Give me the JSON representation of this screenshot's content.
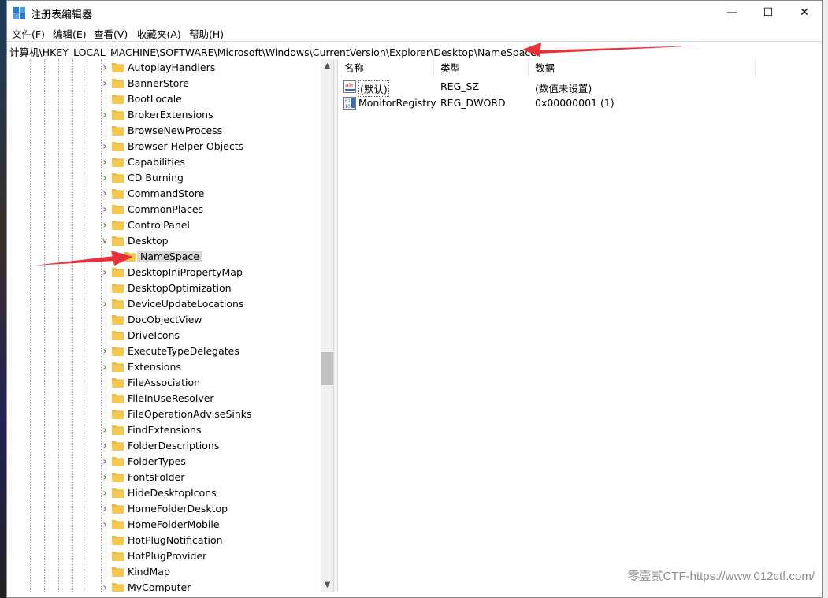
{
  "window": {
    "title": "注册表编辑器"
  },
  "window_controls": {
    "minimize": "—",
    "maximize": "☐",
    "close": "✕"
  },
  "menu": [
    "文件(F)",
    "编辑(E)",
    "查看(V)",
    "收藏夹(A)",
    "帮助(H)"
  ],
  "address": {
    "path": "计算机\\HKEY_LOCAL_MACHINE\\SOFTWARE\\Microsoft\\Windows\\CurrentVersion\\Explorer\\Desktop\\NameSpace"
  },
  "tree": {
    "items": [
      {
        "label": "AutoplayHandlers",
        "state": "collapsed"
      },
      {
        "label": "BannerStore",
        "state": "collapsed"
      },
      {
        "label": "BootLocale",
        "state": "none"
      },
      {
        "label": "BrokerExtensions",
        "state": "collapsed"
      },
      {
        "label": "BrowseNewProcess",
        "state": "none"
      },
      {
        "label": "Browser Helper Objects",
        "state": "collapsed"
      },
      {
        "label": "Capabilities",
        "state": "collapsed"
      },
      {
        "label": "CD Burning",
        "state": "collapsed"
      },
      {
        "label": "CommandStore",
        "state": "collapsed"
      },
      {
        "label": "CommonPlaces",
        "state": "collapsed"
      },
      {
        "label": "ControlPanel",
        "state": "collapsed"
      },
      {
        "label": "Desktop",
        "state": "expanded"
      },
      {
        "label": "NameSpace",
        "state": "selected"
      },
      {
        "label": "DesktopIniPropertyMap",
        "state": "collapsed"
      },
      {
        "label": "DesktopOptimization",
        "state": "none"
      },
      {
        "label": "DeviceUpdateLocations",
        "state": "collapsed"
      },
      {
        "label": "DocObjectView",
        "state": "none"
      },
      {
        "label": "DriveIcons",
        "state": "none"
      },
      {
        "label": "ExecuteTypeDelegates",
        "state": "collapsed"
      },
      {
        "label": "Extensions",
        "state": "collapsed"
      },
      {
        "label": "FileAssociation",
        "state": "none"
      },
      {
        "label": "FileInUseResolver",
        "state": "none"
      },
      {
        "label": "FileOperationAdviseSinks",
        "state": "none"
      },
      {
        "label": "FindExtensions",
        "state": "collapsed"
      },
      {
        "label": "FolderDescriptions",
        "state": "collapsed"
      },
      {
        "label": "FolderTypes",
        "state": "collapsed"
      },
      {
        "label": "FontsFolder",
        "state": "collapsed"
      },
      {
        "label": "HideDesktopIcons",
        "state": "collapsed"
      },
      {
        "label": "HomeFolderDesktop",
        "state": "collapsed"
      },
      {
        "label": "HomeFolderMobile",
        "state": "collapsed"
      },
      {
        "label": "HotPlugNotification",
        "state": "none"
      },
      {
        "label": "HotPlugProvider",
        "state": "none"
      },
      {
        "label": "KindMap",
        "state": "none"
      },
      {
        "label": "MyComputer",
        "state": "collapsed"
      }
    ]
  },
  "list": {
    "columns": [
      "名称",
      "类型",
      "数据"
    ],
    "rows": [
      {
        "name": "(默认)",
        "type": "REG_SZ",
        "data": "(数值未设置)",
        "icon": "string-value-icon"
      },
      {
        "name": "MonitorRegistry",
        "type": "REG_DWORD",
        "data": "0x00000001 (1)",
        "icon": "binary-value-icon"
      }
    ]
  },
  "watermark": "零壹贰CTF-https://www.012ctf.com/",
  "colors": {
    "folder": "#f4c94e",
    "annotation_arrow": "#e8323a",
    "selection": "#d9d9d9"
  }
}
